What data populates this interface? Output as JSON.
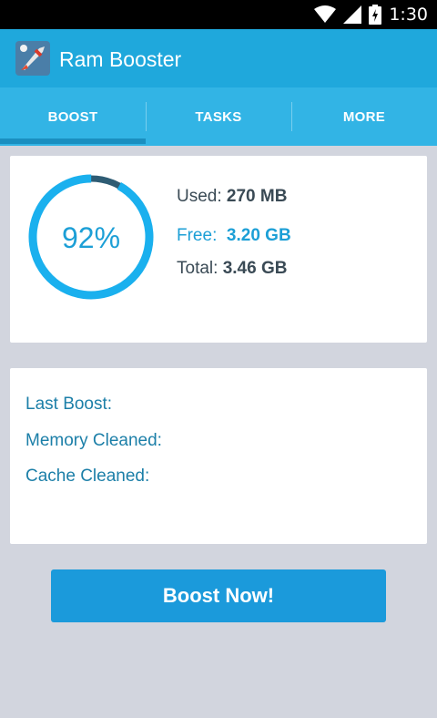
{
  "status_bar": {
    "time": "1:30",
    "icons": [
      "wifi-icon",
      "signal-icon",
      "battery-icon"
    ]
  },
  "app_bar": {
    "title": "Ram Booster",
    "logo_icon": "rocket-logo-icon"
  },
  "tabs": [
    {
      "label": "BOOST",
      "selected": true
    },
    {
      "label": "TASKS",
      "selected": false
    },
    {
      "label": "MORE",
      "selected": false
    }
  ],
  "memory": {
    "percent_label": "92%",
    "percent_value": 92,
    "used_label": "Used:",
    "used_value": "270 MB",
    "free_label": "Free:",
    "free_value": "3.20 GB",
    "total_label": "Total:",
    "total_value": "3.46 GB"
  },
  "boost_info": {
    "last_boost_label": "Last Boost:",
    "memory_cleaned_label": "Memory Cleaned:",
    "cache_cleaned_label": "Cache Cleaned:"
  },
  "boost_button": {
    "label": "Boost Now!"
  },
  "colors": {
    "app_bar": "#1fa8dc",
    "tab_bar": "#32b4e5",
    "accent": "#1c9fd6",
    "gauge_arc": "#1ab0ee",
    "gauge_remaining": "#2e5c74",
    "background": "#d2d5de"
  }
}
